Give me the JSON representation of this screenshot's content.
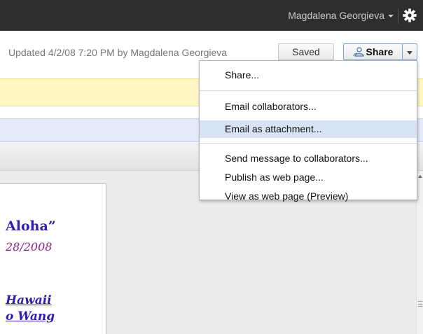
{
  "topbar": {
    "user_name": "Magdalena Georgieva",
    "settings_icon": "gear-icon",
    "background": "#2e2e2e"
  },
  "doc_info": {
    "updated_text": "Updated 4/2/08 7:20 PM by Magdalena Georgieva",
    "saved_label": "Saved",
    "share_label": "Share",
    "share_icon": "share-people-icon"
  },
  "share_menu": {
    "items": [
      "Share...",
      "Email collaborators...",
      "Email as attachment...",
      "Send message to collaborators...",
      "Publish as web page...",
      "View as web page (Preview)"
    ],
    "highlighted": "Email as attachment...",
    "highlight_color": "#d6e4f5"
  },
  "document": {
    "heading": "Aloha”",
    "date": "28/2008",
    "link1": "Hawaii",
    "link2": "o Wang"
  },
  "colors": {
    "notice_yellow": "#fff8c4",
    "notice_blue": "#e4ecfc",
    "doc_blue": "#2e1fb4",
    "doc_purple": "#8a1f8a"
  }
}
